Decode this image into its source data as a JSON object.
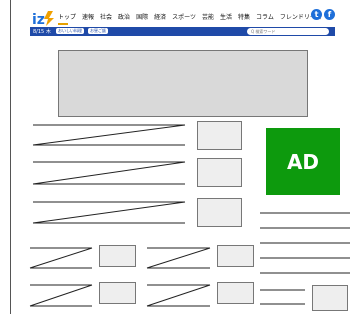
{
  "header": {
    "logo_icon": "iza-logo-icon",
    "menu": [
      "トップ",
      "速報",
      "社会",
      "政治",
      "国際",
      "経済",
      "スポーツ",
      "芸能",
      "生活",
      "特集",
      "コラム",
      "フレンドリーズ"
    ],
    "sns": [
      "twitter-icon",
      "facebook-icon"
    ]
  },
  "navbar": {
    "date": "8/15 木",
    "pill1": "おいしい料理",
    "pill2": "お昼ご飯",
    "search_placeholder": "Q 検索ワード"
  },
  "ad": {
    "label": "AD"
  }
}
